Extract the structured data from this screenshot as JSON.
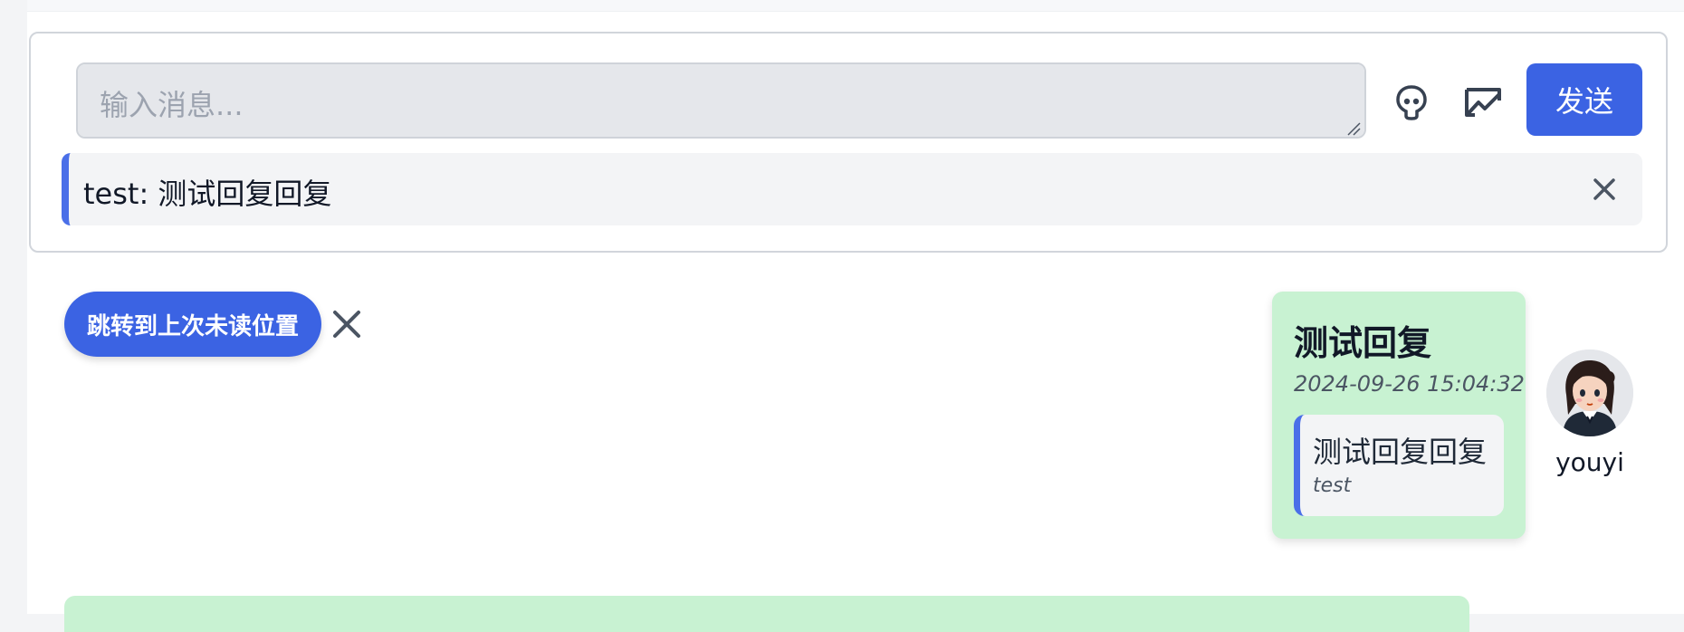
{
  "composer": {
    "input_placeholder": "输入消息...",
    "input_value": "",
    "send_label": "发送",
    "icons": [
      "emoji-icon",
      "image-icon"
    ]
  },
  "reply": {
    "text": "test: 测试回复回复"
  },
  "jump": {
    "label": "跳转到上次未读位置"
  },
  "message": {
    "title": "测试回复",
    "timestamp": "2024-09-26 15:04:32",
    "quote_text": "测试回复回复",
    "quote_author": "test",
    "username": "youyi"
  },
  "colors": {
    "accent": "#3b63e3",
    "bubble": "#c8f2d2",
    "quote_border": "#4a6fe8"
  }
}
